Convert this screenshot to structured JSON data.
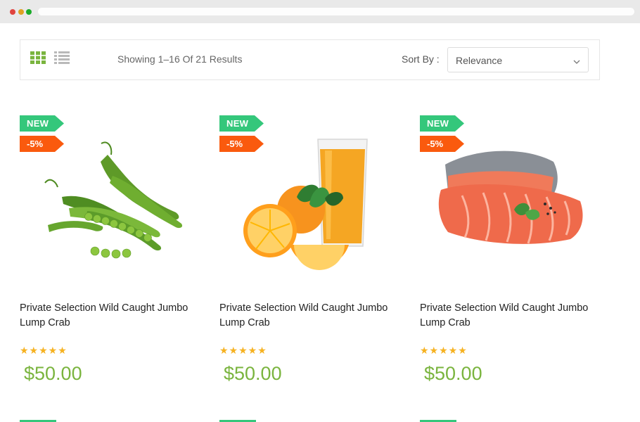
{
  "toolbar": {
    "results_text": "Showing 1–16 Of 21 Results",
    "sort_label": "Sort By :",
    "sort_value": "Relevance",
    "grid_view_icon": "grid-view-icon",
    "list_view_icon": "list-view-icon"
  },
  "colors": {
    "accent_green": "#7ab43e",
    "new_badge": "#34c77b",
    "sale_badge": "#fa5a0e",
    "star": "#f6b221"
  },
  "products": [
    {
      "badge_new": "NEW",
      "badge_discount": "-5%",
      "image": "green-peas-image",
      "title": "Private Selection Wild Caught Jumbo Lump Crab",
      "stars": "★★★★★",
      "rating": 5,
      "price": "$50.00"
    },
    {
      "badge_new": "NEW",
      "badge_discount": "-5%",
      "image": "orange-juice-image",
      "title": "Private Selection Wild Caught Jumbo Lump Crab",
      "stars": "★★★★★",
      "rating": 5,
      "price": "$50.00"
    },
    {
      "badge_new": "NEW",
      "badge_discount": "-5%",
      "image": "salmon-fillet-image",
      "title": "Private Selection Wild Caught Jumbo Lump Crab",
      "stars": "★★★★★",
      "rating": 5,
      "price": "$50.00"
    }
  ]
}
